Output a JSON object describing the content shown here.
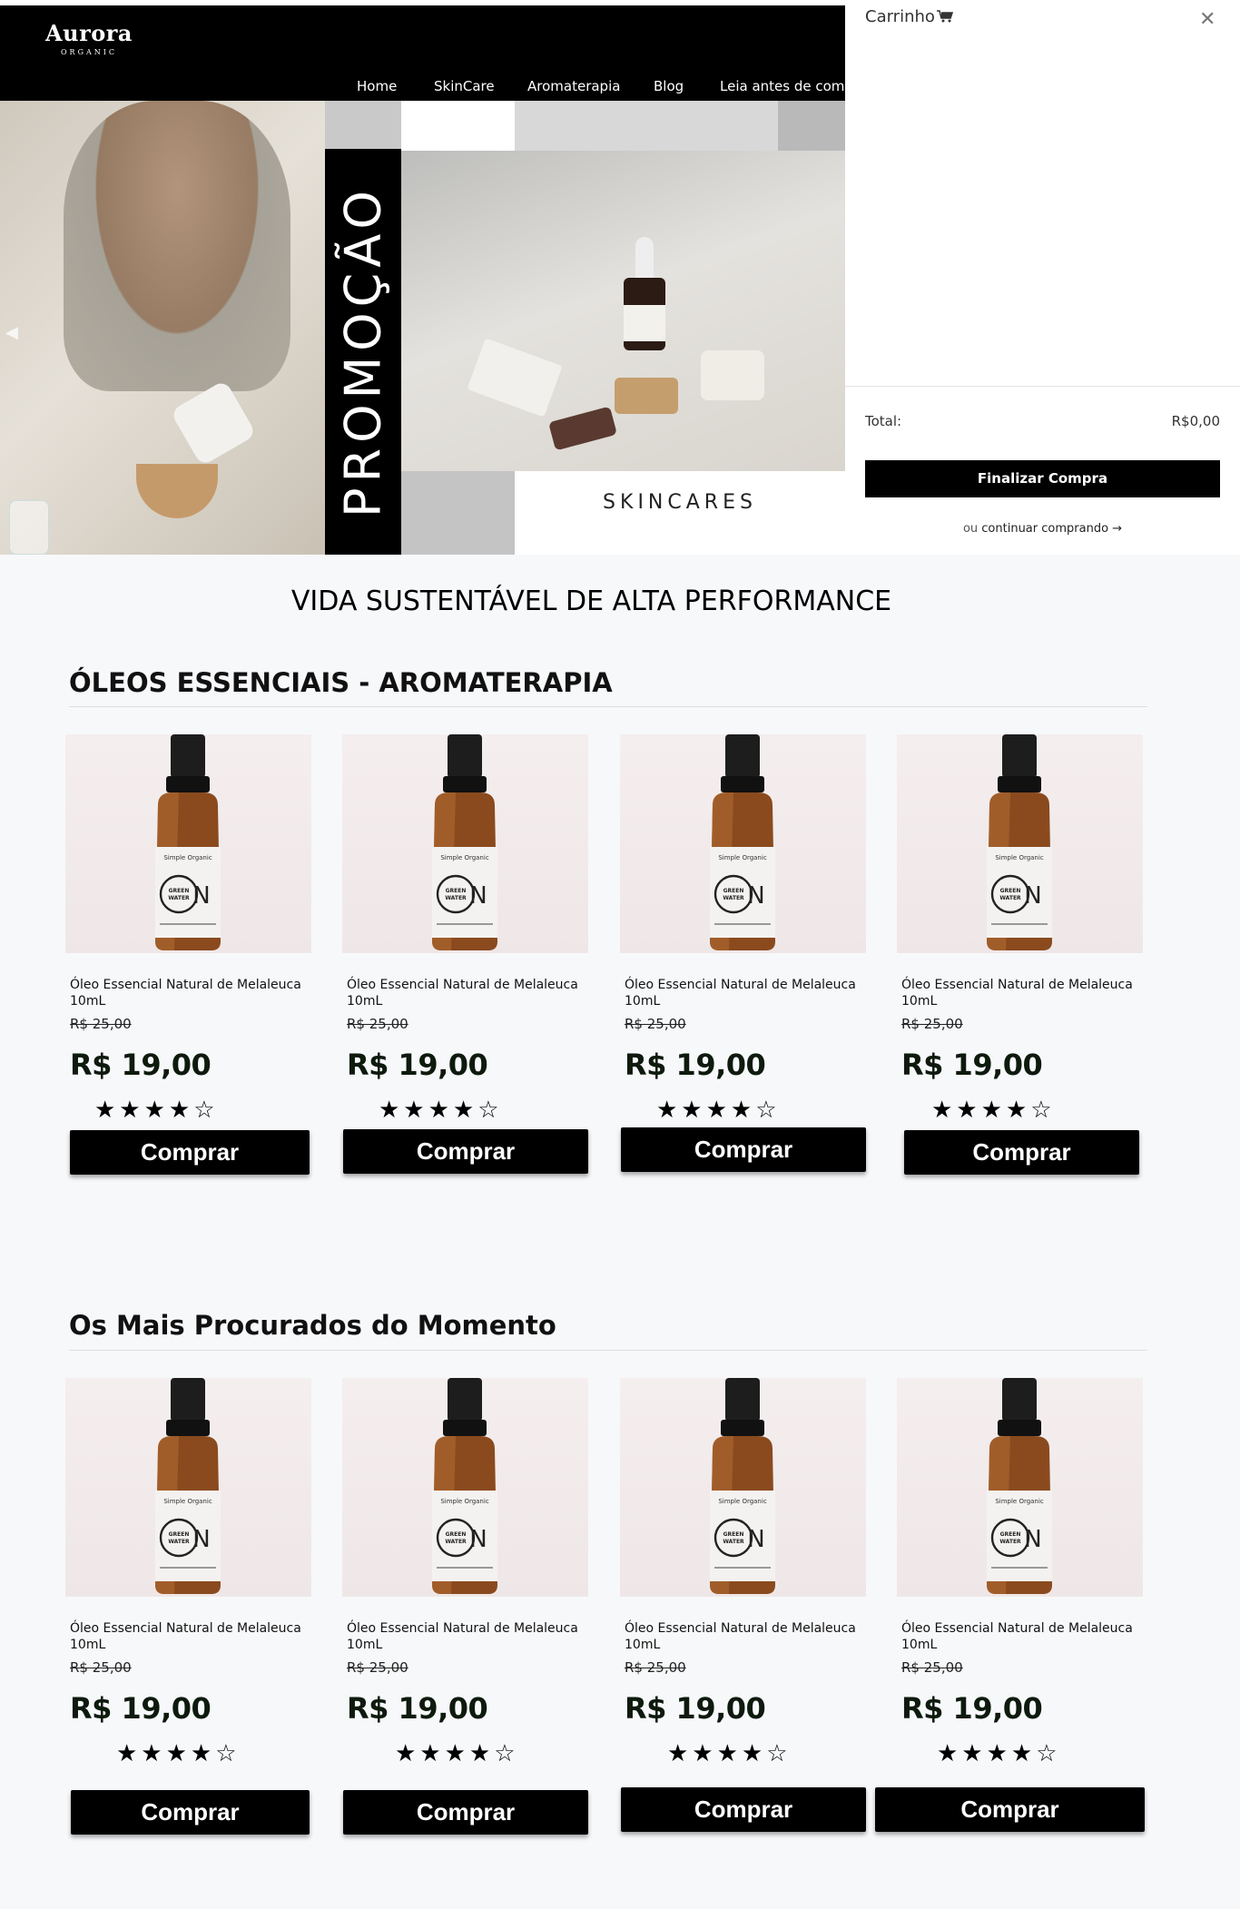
{
  "brand": {
    "name": "Aurora",
    "sub": "ORGANIC"
  },
  "nav": [
    "Home",
    "SkinCare",
    "Aromaterapia",
    "Blog",
    "Leia antes de comp"
  ],
  "hero": {
    "banner_text": "PROMOÇÃO",
    "label": "SKINCARES",
    "slide_count": 2,
    "active_slide": 1
  },
  "cart": {
    "title": "Carrinho",
    "total_label": "Total:",
    "total_value": "R$0,00",
    "checkout_label": "Finalizar Compra",
    "continue_prefix": "ou",
    "continue_link": "continuar comprando →"
  },
  "tagline": "VIDA SUSTENTÁVEL DE ALTA PERFORMANCE",
  "sections": [
    {
      "title": "ÓLEOS ESSENCIAIS - AROMATERAPIA",
      "products": [
        {
          "name": "Óleo Essencial Natural de Melaleuca 10mL",
          "old_price": "R$ 25,00",
          "price": "R$ 19,00",
          "rating": 4,
          "button": "Comprar"
        },
        {
          "name": "Óleo Essencial Natural de Melaleuca 10mL",
          "old_price": "R$ 25,00",
          "price": "R$ 19,00",
          "rating": 4,
          "button": "Comprar"
        },
        {
          "name": "Óleo Essencial Natural de Melaleuca 10mL",
          "old_price": "R$ 25,00",
          "price": "R$ 19,00",
          "rating": 4,
          "button": "Comprar"
        },
        {
          "name": "Óleo Essencial Natural de Melaleuca 10mL",
          "old_price": "R$ 25,00",
          "price": "R$ 19,00",
          "rating": 4,
          "button": "Comprar"
        }
      ]
    },
    {
      "title": "Os Mais Procurados do Momento",
      "products": [
        {
          "name": "Óleo Essencial Natural de Melaleuca 10mL",
          "old_price": "R$ 25,00",
          "price": "R$ 19,00",
          "rating": 4,
          "button": "Comprar"
        },
        {
          "name": "Óleo Essencial Natural de Melaleuca 10mL",
          "old_price": "R$ 25,00",
          "price": "R$ 19,00",
          "rating": 4,
          "button": "Comprar"
        },
        {
          "name": "Óleo Essencial Natural de Melaleuca 10mL",
          "old_price": "R$ 25,00",
          "price": "R$ 19,00",
          "rating": 4,
          "button": "Comprar"
        },
        {
          "name": "Óleo Essencial Natural de Melaleuca 10mL",
          "old_price": "R$ 25,00",
          "price": "R$ 19,00",
          "rating": 4,
          "button": "Comprar"
        }
      ]
    }
  ],
  "product_image": {
    "brand": "Simple Organic",
    "label": "GREEN WATER",
    "letter": "N"
  },
  "icons": {
    "cart": "shopping-cart-icon",
    "close": "close-icon",
    "star": "star-icon",
    "slider_prev": "chevron-left-icon"
  },
  "colors": {
    "header_bg": "#000000",
    "button_bg": "#000000",
    "page_bg": "#f7f8fa",
    "price": "#0d1a0d"
  }
}
